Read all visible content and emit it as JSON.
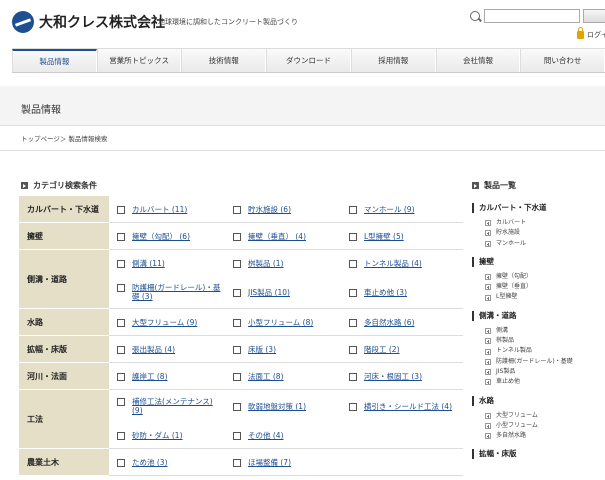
{
  "header": {
    "company_name": "大和クレス株式会社",
    "tagline": "地球環境に調和したコンクリート製品づくり",
    "login_label": "ログイン"
  },
  "nav": {
    "items": [
      "製品情報",
      "営業所トピックス",
      "技術情報",
      "ダウンロード",
      "採用情報",
      "会社情報",
      "問い合わせ"
    ],
    "active_index": 0
  },
  "page": {
    "title": "製品情報",
    "breadcrumb": "トップページ＞ 製品情報検索"
  },
  "category_search": {
    "title": "カテゴリ検索条件",
    "rows": [
      {
        "label": "カルバート・下水道",
        "lines": [
          [
            "カルバート (11)",
            "貯水施設 (6)",
            "マンホール (9)"
          ]
        ]
      },
      {
        "label": "擁壁",
        "lines": [
          [
            "擁壁（勾配） (6)",
            "擁壁（垂直） (4)",
            "L型擁壁 (5)"
          ]
        ]
      },
      {
        "label": "側溝・道路",
        "lines": [
          [
            "側溝 (11)",
            "桝製品 (1)",
            "トンネル製品 (4)"
          ],
          [
            "防護柵(ガードレール)・基礎 (3)",
            "JIS製品 (10)",
            "車止め他 (3)"
          ]
        ]
      },
      {
        "label": "水路",
        "lines": [
          [
            "大型フリューム (9)",
            "小型フリューム (8)",
            "多自然水路 (6)"
          ]
        ]
      },
      {
        "label": "拡幅・床版",
        "lines": [
          [
            "張出製品 (4)",
            "床版 (3)",
            "階段工 (2)"
          ]
        ]
      },
      {
        "label": "河川・法面",
        "lines": [
          [
            "護岸工 (8)",
            "法面工 (8)",
            "河床・根固工 (3)"
          ]
        ]
      },
      {
        "label": "工法",
        "lines": [
          [
            "補修工法(メンテナンス) (9)",
            "軟弱地盤対策 (1)",
            "横引き・シールド工法 (4)"
          ],
          [
            "砂防・ダム (1)",
            "その他 (4)"
          ]
        ]
      },
      {
        "label": "農業土木",
        "lines": [
          [
            "ため池 (3)",
            "ほ場整備 (7)"
          ]
        ]
      }
    ]
  },
  "product_list": {
    "title": "製品一覧",
    "groups": [
      {
        "name": "カルバート・下水道",
        "items": [
          "カルバート",
          "貯水施設",
          "マンホール"
        ]
      },
      {
        "name": "擁壁",
        "items": [
          "擁壁（勾配）",
          "擁壁（垂直）",
          "L型擁壁"
        ]
      },
      {
        "name": "側溝・道路",
        "items": [
          "側溝",
          "桝製品",
          "トンネル製品",
          "防護柵(ガードレール)・基礎",
          "JIS製品",
          "車止め他"
        ]
      },
      {
        "name": "水路",
        "items": [
          "大型フリューム",
          "小型フリューム",
          "多自然水路"
        ]
      },
      {
        "name": "拡幅・床版",
        "items": []
      }
    ]
  },
  "colors": {
    "brand_blue": "#1d4f91",
    "category_header_bg": "#e5dfc8",
    "login_lock": "#e2a400"
  }
}
